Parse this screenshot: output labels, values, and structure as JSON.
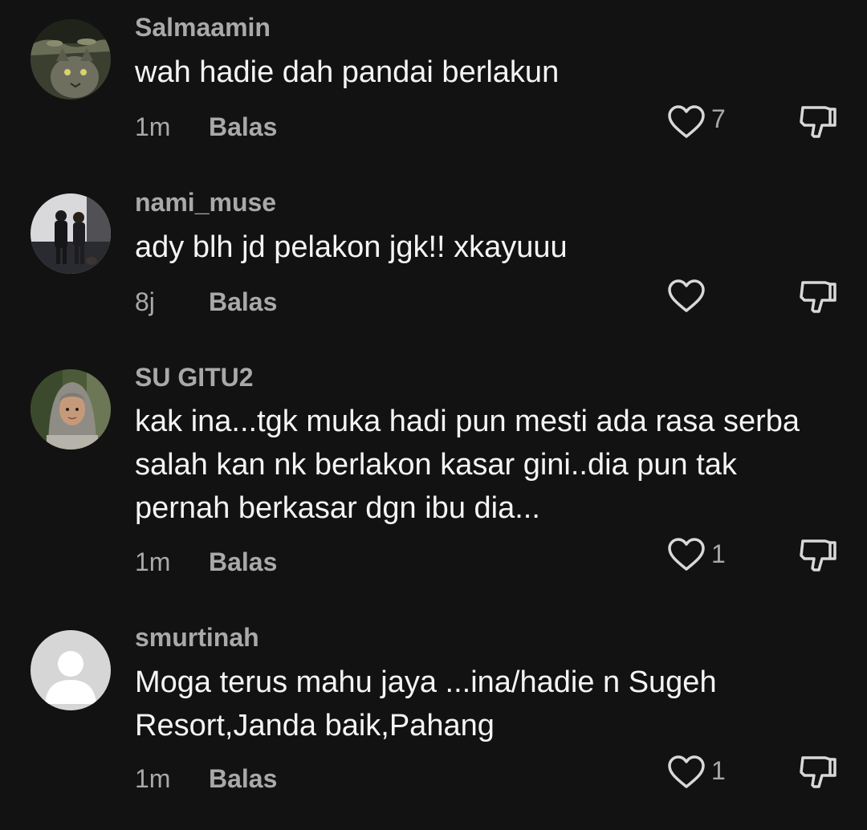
{
  "comments": [
    {
      "username": "Salmaamin",
      "text": "wah hadie dah pandai berlakun",
      "time": "1m",
      "reply_label": "Balas",
      "likes": "7",
      "avatar": "cat-photo"
    },
    {
      "username": "nami_muse",
      "text": "ady blh jd pelakon jgk!! xkayuuu",
      "time": "8j",
      "reply_label": "Balas",
      "likes": "",
      "avatar": "couple-photo"
    },
    {
      "username": "SU GITU2",
      "text": "kak ina...tgk muka hadi pun mesti ada rasa serba salah kan nk berlakon kasar gini..dia pun tak pernah berkasar dgn ibu dia...",
      "time": "1m",
      "reply_label": "Balas",
      "likes": "1",
      "avatar": "hijab-woman-photo"
    },
    {
      "username": "smurtinah",
      "text": "Moga terus mahu jaya ...ina/hadie n Sugeh Resort,Janda baik,Pahang",
      "time": "1m",
      "reply_label": "Balas",
      "likes": "1",
      "avatar": "default-avatar"
    }
  ],
  "icons": {
    "like": "heart-outline-icon",
    "dislike": "thumbs-down-icon"
  },
  "colors": {
    "background": "#121212",
    "primary_text": "#f4f4f4",
    "secondary_text": "#a9a9a9"
  }
}
